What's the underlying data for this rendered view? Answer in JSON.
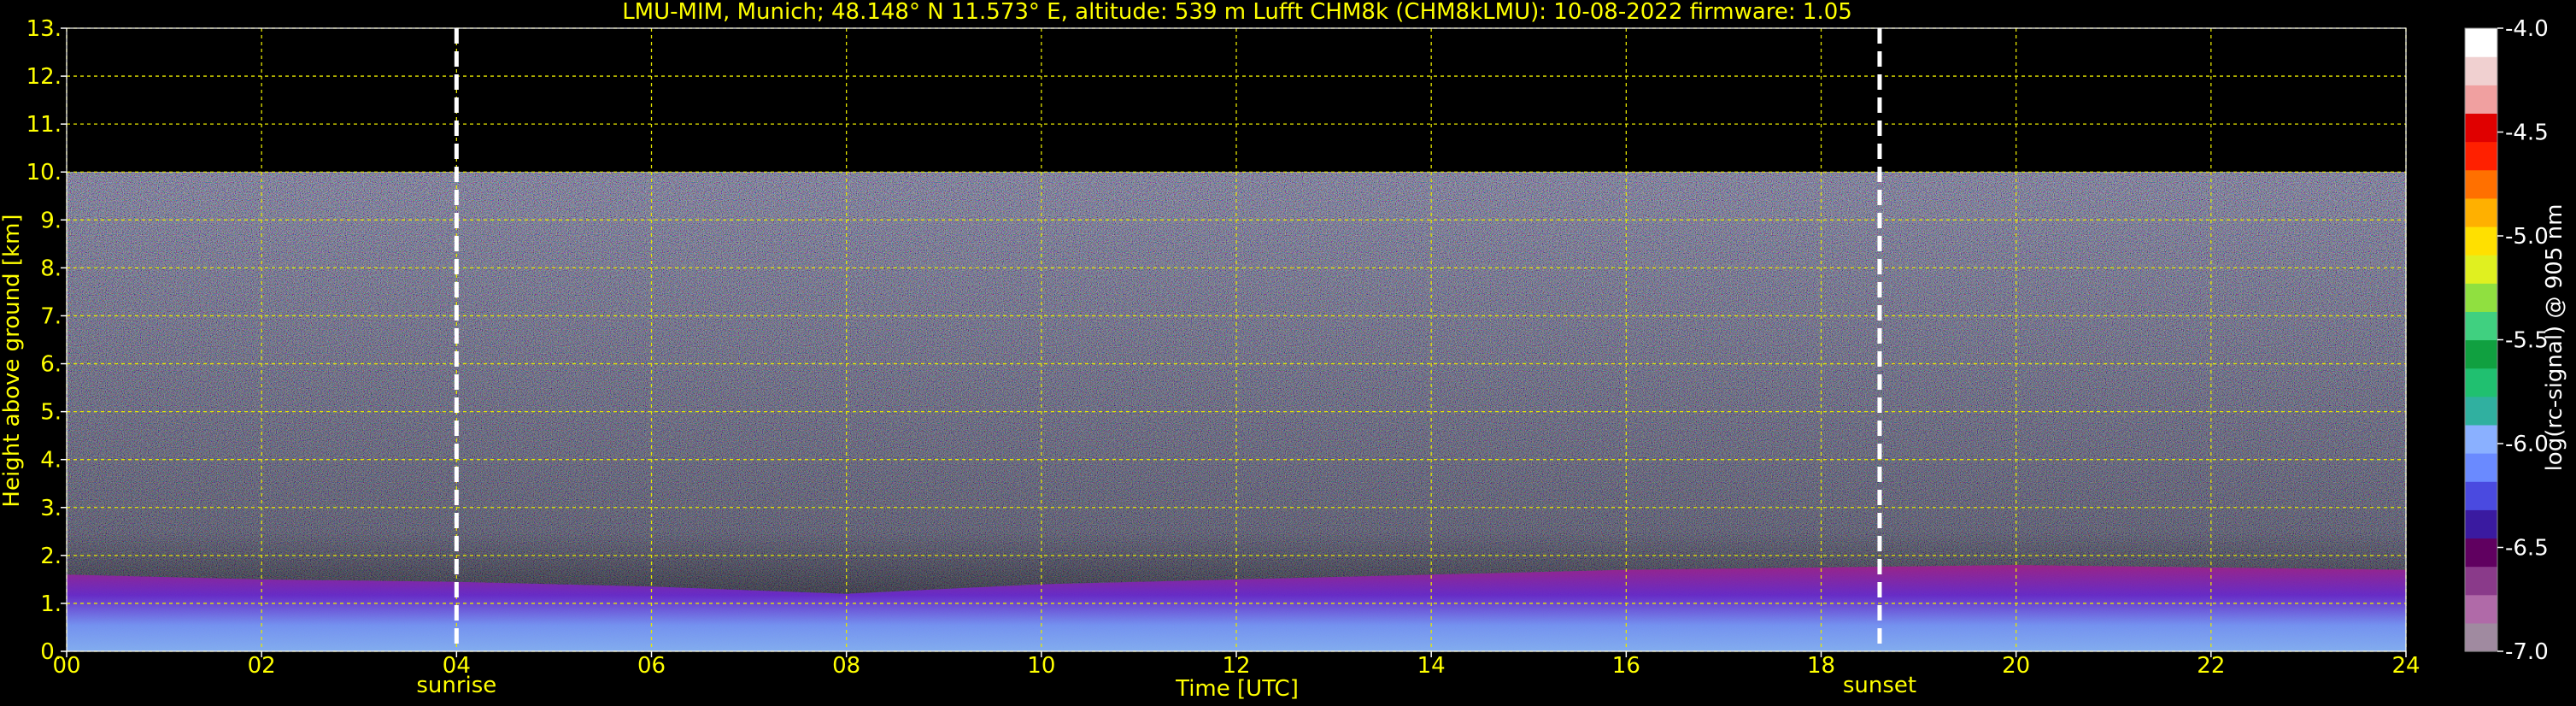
{
  "chart_data": {
    "type": "heatmap",
    "title": "LMU-MIM, Munich; 48.148° N 11.573° E, altitude: 539 m    Lufft CHM8k (CHM8kLMU): 10-08-2022    firmware: 1.05",
    "xlabel": "Time [UTC]",
    "ylabel": "Height above ground [km]",
    "xlim": [
      0,
      24
    ],
    "ylim": [
      0,
      13
    ],
    "x_ticks": [
      "00",
      "02",
      "04",
      "06",
      "08",
      "10",
      "12",
      "14",
      "16",
      "18",
      "20",
      "22",
      "24"
    ],
    "y_ticks": [
      "0.",
      "1.",
      "2.",
      "3.",
      "4.",
      "5.",
      "6.",
      "7.",
      "8.",
      "9.",
      "10.",
      "11.",
      "12.",
      "13."
    ],
    "grid": true,
    "grid_color": "#e6e600",
    "text_color": "#ffff00",
    "background": "#000000",
    "markers": [
      {
        "label": "sunrise",
        "x": 4.0
      },
      {
        "label": "sunset",
        "x": 18.6
      }
    ],
    "data_top_km": 10.0,
    "colorbar": {
      "label": "log(rc-signal) @ 905 nm",
      "min": -7.0,
      "max": -4.0,
      "ticks": [
        "-4.0",
        "-4.5",
        "-5.0",
        "-5.5",
        "-6.0",
        "-6.5",
        "-7.0"
      ],
      "colors": [
        "#a08aa0",
        "#b06aa8",
        "#8a3a8a",
        "#600060",
        "#3a1aa0",
        "#4a4ae0",
        "#6a8aff",
        "#8ab0ff",
        "#30b0a0",
        "#20c070",
        "#10a040",
        "#40d080",
        "#90e040",
        "#e0f020",
        "#ffe000",
        "#ffb000",
        "#ff7000",
        "#ff2000",
        "#e00000",
        "#f0a0a0",
        "#f0d0d0",
        "#ffffff"
      ]
    },
    "boundary_layer": [
      {
        "t": 0,
        "h": 1.6
      },
      {
        "t": 2,
        "h": 1.5
      },
      {
        "t": 4,
        "h": 1.45
      },
      {
        "t": 6,
        "h": 1.35
      },
      {
        "t": 8,
        "h": 1.2
      },
      {
        "t": 10,
        "h": 1.4
      },
      {
        "t": 12,
        "h": 1.5
      },
      {
        "t": 14,
        "h": 1.6
      },
      {
        "t": 16,
        "h": 1.7
      },
      {
        "t": 18,
        "h": 1.75
      },
      {
        "t": 20,
        "h": 1.8
      },
      {
        "t": 22,
        "h": 1.75
      },
      {
        "t": 24,
        "h": 1.7
      }
    ]
  }
}
